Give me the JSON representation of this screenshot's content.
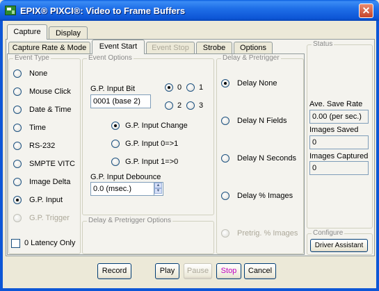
{
  "window": {
    "title": "EPIX® PIXCI®: Video to Frame Buffers",
    "close_symbol": "✕"
  },
  "top_tabs": [
    {
      "label": "Capture",
      "selected": true
    },
    {
      "label": "Display",
      "selected": false
    }
  ],
  "sub_tabs": [
    {
      "label": "Capture Rate & Mode",
      "enabled": true,
      "selected": false
    },
    {
      "label": "Event Start",
      "enabled": true,
      "selected": true
    },
    {
      "label": "Event Stop",
      "enabled": false,
      "selected": false
    },
    {
      "label": "Strobe",
      "enabled": true,
      "selected": false
    },
    {
      "label": "Options",
      "enabled": true,
      "selected": false
    }
  ],
  "event_type": {
    "title": "Event Type",
    "options": [
      {
        "label": "None",
        "checked": false,
        "enabled": true
      },
      {
        "label": "Mouse Click",
        "checked": false,
        "enabled": true
      },
      {
        "label": "Date & Time",
        "checked": false,
        "enabled": true
      },
      {
        "label": "Time",
        "checked": false,
        "enabled": true
      },
      {
        "label": "RS-232",
        "checked": false,
        "enabled": true
      },
      {
        "label": "SMPTE VITC",
        "checked": false,
        "enabled": true
      },
      {
        "label": "Image Delta",
        "checked": false,
        "enabled": true
      },
      {
        "label": "G.P. Input",
        "checked": true,
        "enabled": true
      },
      {
        "label": "G.P. Trigger",
        "checked": false,
        "enabled": false
      }
    ],
    "latency_checkbox": {
      "label": "0 Latency Only",
      "checked": false
    }
  },
  "event_options": {
    "title": "Event Options",
    "gp_input_bit_label": "G.P. Input Bit",
    "gp_input_bit_value": "0001 (base 2)",
    "bit_options": [
      {
        "label": "0",
        "checked": true
      },
      {
        "label": "1",
        "checked": false
      },
      {
        "label": "2",
        "checked": false
      },
      {
        "label": "3",
        "checked": false
      }
    ],
    "trigger_options": [
      {
        "label": "G.P. Input Change",
        "checked": true
      },
      {
        "label": "G.P. Input 0=>1",
        "checked": false
      },
      {
        "label": "G.P. Input 1=>0",
        "checked": false
      }
    ],
    "debounce_label": "G.P. Input Debounce",
    "debounce_value": "0.0 (msec.)"
  },
  "delay_options": {
    "title": "Delay & Pretrigger Options"
  },
  "delay_pretrigger": {
    "title": "Delay & Pretrigger",
    "options": [
      {
        "label": "Delay None",
        "checked": true,
        "enabled": true
      },
      {
        "label": "Delay N Fields",
        "checked": false,
        "enabled": true
      },
      {
        "label": "Delay N Seconds",
        "checked": false,
        "enabled": true
      },
      {
        "label": "Delay % Images",
        "checked": false,
        "enabled": true
      },
      {
        "label": "Pretrig. % Images",
        "checked": false,
        "enabled": false
      }
    ]
  },
  "status": {
    "title": "Status",
    "save_rate_label": "Ave. Save Rate",
    "save_rate_value": "0.00 (per sec.)",
    "images_saved_label": "Images Saved",
    "images_saved_value": "0",
    "images_captured_label": "Images Captured",
    "images_captured_value": "0"
  },
  "configure": {
    "title": "Configure",
    "driver_assistant_label": "Driver Assistant"
  },
  "bottom_buttons": {
    "record": "Record",
    "play": "Play",
    "pause": "Pause",
    "stop": "Stop",
    "cancel": "Cancel"
  }
}
